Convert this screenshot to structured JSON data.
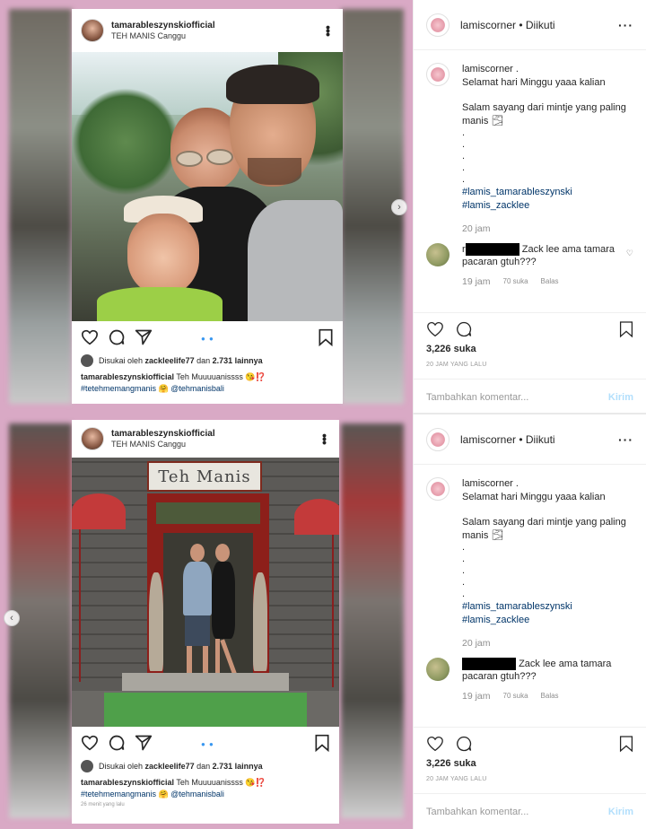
{
  "post1": {
    "header": {
      "username": "tamarableszynskiofficial",
      "location": "TEH MANIS Canggu"
    },
    "liked_by_prefix": "Disukai oleh",
    "liked_by_user": "zackleelife77",
    "liked_by_and": "dan",
    "liked_by_count": "2.731 lainnya",
    "caption_user": "tamarableszynskiofficial",
    "caption_text": "Teh Muuuuanissss 😘⁉️",
    "caption_tags": "#tetehmemangmanis 🤗 @tehmanisbali",
    "time": ""
  },
  "post2": {
    "header": {
      "username": "tamarableszynskiofficial",
      "location": "TEH MANIS Canggu"
    },
    "sign_text": "Teh Manis",
    "liked_by_prefix": "Disukai oleh",
    "liked_by_user": "zackleelife77",
    "liked_by_and": "dan",
    "liked_by_count": "2.731 lainnya",
    "caption_user": "tamarableszynskiofficial",
    "caption_text": "Teh Muuuuanissss 😘⁉️",
    "caption_tags": "#tetehmemangmanis 🤗 @tehmanisbali",
    "time": "26 menit yang lalu"
  },
  "right": {
    "username": "lamiscorner",
    "follow_state": "• Diikuti",
    "post_user": "lamiscorner .",
    "post_line1": "Selamat hari Minggu yaaa kalian",
    "post_line2": "Salam sayang dari mintje yang paling manis 🌫",
    "post_dots": ".\n.\n.\n.\n.",
    "tag1": "#lamis_tamarableszynski",
    "tag2": "#lamis_zacklee",
    "post_time": "20 jam",
    "comment_prefix": "r",
    "comment_text": "Zack lee ama tamara pacaran gtuh???",
    "comment_time": "19 jam",
    "comment_likes": "70 suka",
    "comment_reply": "Balas",
    "likes": "3,226 suka",
    "date": "20 JAM YANG LALU",
    "add_comment_placeholder": "Tambahkan komentar...",
    "send_label": "Kirim"
  },
  "icons": [
    "heart-icon",
    "comment-icon",
    "share-icon",
    "bookmark-icon",
    "more-icon",
    "chevron-right-icon",
    "chevron-left-icon"
  ]
}
